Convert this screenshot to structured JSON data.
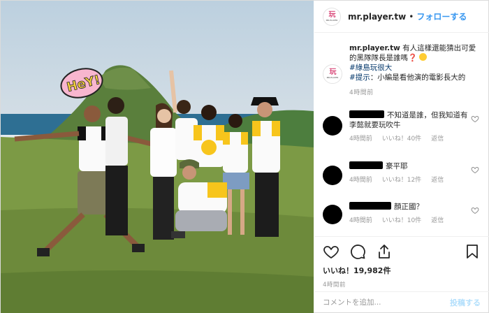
{
  "account": {
    "logo_mark": "玩",
    "logo_text": "MR.PLAYER",
    "username": "mr.player.tw",
    "separator": "•",
    "follow_label": "フォローする"
  },
  "photo": {
    "hey_text": "HeY!"
  },
  "caption": {
    "username": "mr.player.tw",
    "line1": " 有人這樣還能猜出可愛的黑隊隊長是誰嗎",
    "qmark": "❓",
    "hashtag": "#綠島玩很大",
    "hint_tag": "#提示",
    "hint_text": "：小編是看他演的電影長大的",
    "time": "4時間前"
  },
  "comments": [
    {
      "text": "不知道是誰，但我知道有李懿就要玩吹牛",
      "time": "4時間前",
      "likes": "いいね！40件",
      "reply": "返信"
    },
    {
      "text": "豪平耶",
      "time": "4時間前",
      "likes": "いいね！12件",
      "reply": "返信"
    },
    {
      "text": "顏正國？",
      "time": "4時間前",
      "likes": "いいね！10件",
      "reply": "返信"
    }
  ],
  "actions": {
    "likes": "いいね！19,982件",
    "post_time": "4時間前"
  },
  "comment_box": {
    "placeholder": "コメントを追加...",
    "post_label": "投稿する"
  },
  "colors": {
    "link_blue": "#3897f0",
    "hashtag_blue": "#003569",
    "post_disabled": "#b2dffc",
    "muted": "#999999"
  },
  "icons": [
    "heart-icon",
    "comment-icon",
    "share-icon",
    "bookmark-icon",
    "like-heart-icon"
  ]
}
